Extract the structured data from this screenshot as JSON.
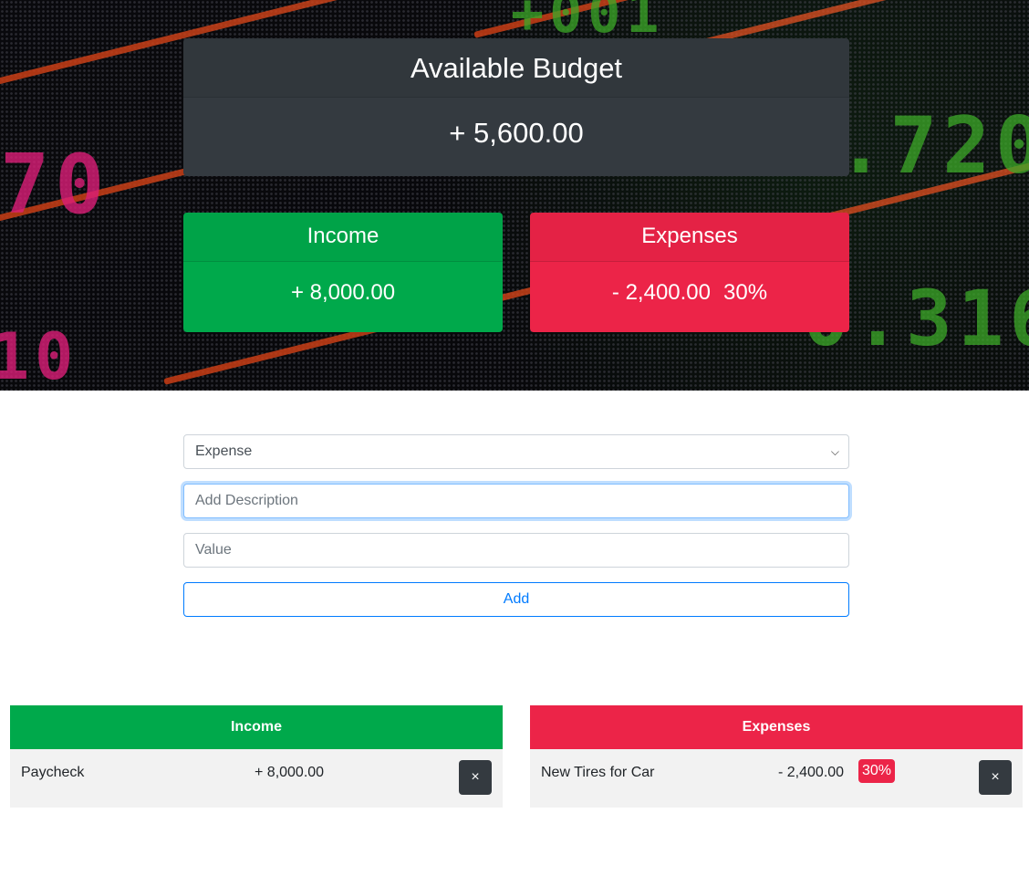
{
  "budget": {
    "title": "Available Budget",
    "amount": "+ 5,600.00"
  },
  "summary": {
    "income": {
      "title": "Income",
      "amount": "+ 8,000.00"
    },
    "expenses": {
      "title": "Expenses",
      "amount": "- 2,400.00",
      "percent": "30%"
    }
  },
  "form": {
    "type_selected": "Expense",
    "description_placeholder": "Add Description",
    "value_placeholder": "Value",
    "add_label": "Add"
  },
  "income_list": {
    "header": "Income",
    "items": [
      {
        "description": "Paycheck",
        "amount": "+ 8,000.00",
        "delete_icon": "×"
      }
    ]
  },
  "expense_list": {
    "header": "Expenses",
    "items": [
      {
        "description": "New Tires for Car",
        "amount": "- 2,400.00",
        "percent": "30%",
        "delete_icon": "×"
      }
    ]
  },
  "colors": {
    "income": "#00a94b",
    "expense": "#ec2448",
    "dark": "#343a40",
    "primary": "#007bff"
  }
}
